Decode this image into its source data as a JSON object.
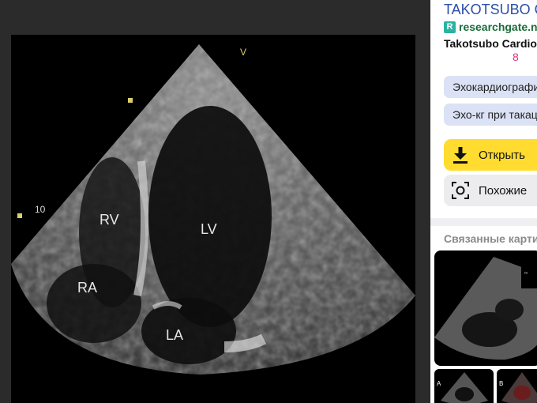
{
  "image": {
    "labels": {
      "rv": "RV",
      "lv": "LV",
      "ra": "RA",
      "la": "LA",
      "depth": "10"
    }
  },
  "panel": {
    "title": "TAKOTSUBO CARDIOMYOPATHY",
    "source": "researchgate.net",
    "subtitle": "Takotsubo Cardiomyopathy",
    "count": "8",
    "tags": [
      "Эхокардиография",
      "Эхо-кг при такацубо"
    ],
    "open_label": "Открыть",
    "similar_label": "Похожие",
    "related_title": "Связанные картинки",
    "related_labels": [
      "A",
      "B"
    ]
  },
  "colors": {
    "accent_yellow": "#ffdc2f",
    "link_blue": "#2a4fa8",
    "source_green": "#1b6c3a",
    "count_pink": "#e0307a"
  }
}
